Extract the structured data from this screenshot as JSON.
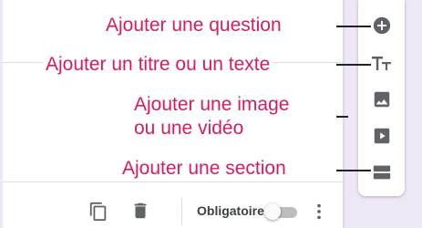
{
  "annotations": {
    "add_question": "Ajouter une question",
    "add_title": "Ajouter un titre ou un texte",
    "add_image_line1": "Ajouter une image",
    "add_image_line2": "ou une vidéo",
    "add_section": "Ajouter une section"
  },
  "toolbar": {
    "icons": [
      "add-circle-icon",
      "title-text-icon",
      "image-icon",
      "video-icon",
      "section-icon"
    ]
  },
  "footer": {
    "required_label": "Obligatoire",
    "required_on": false
  },
  "colors": {
    "annotation": "#d81b60",
    "icon": "#5f6368",
    "background": "#ede7f6"
  }
}
